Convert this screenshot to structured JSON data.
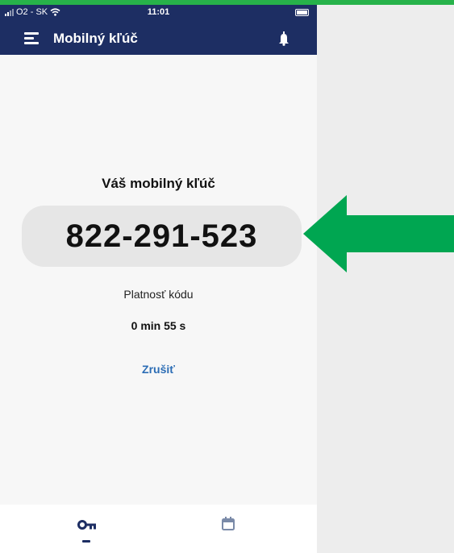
{
  "status_bar": {
    "carrier": "O2 - SK",
    "time": "11:01"
  },
  "app_bar": {
    "title": "Mobilný kľúč",
    "menu_icon": "hamburger-menu-icon",
    "bell_icon": "bell-icon"
  },
  "main": {
    "key_label": "Váš mobilný kľúč",
    "code": "822-291-523",
    "validity_label": "Platnosť kódu",
    "validity_value": "0 min 55 s",
    "cancel_label": "Zrušiť"
  },
  "bottom_nav": {
    "tabs": [
      {
        "icon": "key-icon",
        "active": true
      },
      {
        "icon": "calendar-icon",
        "active": false
      }
    ]
  },
  "colors": {
    "header": "#1d2e63",
    "accent_green": "#27b24a",
    "arrow_green": "#00a651",
    "link_blue": "#2c6db5"
  }
}
